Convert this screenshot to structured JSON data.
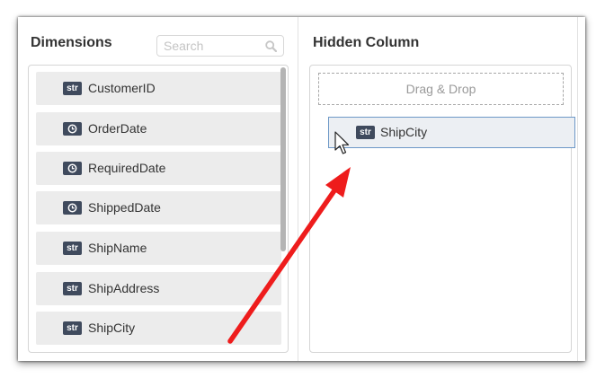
{
  "dimensions": {
    "title": "Dimensions",
    "search_placeholder": "Search",
    "items": [
      {
        "label": "CustomerID",
        "type": "str"
      },
      {
        "label": "OrderDate",
        "type": "date"
      },
      {
        "label": "RequiredDate",
        "type": "date"
      },
      {
        "label": "ShippedDate",
        "type": "date"
      },
      {
        "label": "ShipName",
        "type": "str"
      },
      {
        "label": "ShipAddress",
        "type": "str"
      },
      {
        "label": "ShipCity",
        "type": "str"
      }
    ]
  },
  "hidden_column": {
    "title": "Hidden Column",
    "drop_zone_text": "Drag & Drop"
  },
  "drag_ghost": {
    "label": "ShipCity",
    "type": "str"
  },
  "colors": {
    "type_badge": "#3f4a5d",
    "item_bg": "#ececec",
    "annotation_arrow": "#ee1c1c",
    "drag_border": "#6d98c7"
  }
}
